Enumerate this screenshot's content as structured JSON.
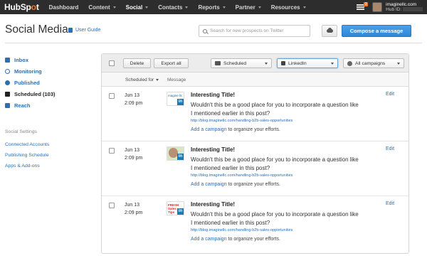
{
  "nav": {
    "logo_prefix": "HubSp",
    "logo_o": "o",
    "logo_suffix": "t",
    "items": [
      {
        "label": "Dashboard"
      },
      {
        "label": "Content"
      },
      {
        "label": "Social"
      },
      {
        "label": "Contacts"
      },
      {
        "label": "Reports"
      },
      {
        "label": "Partner"
      },
      {
        "label": "Resources"
      }
    ],
    "notification_count": "3",
    "account_name": "imaginellc.com",
    "hub_id_label": "Hub ID:"
  },
  "header": {
    "title": "Social Media",
    "user_guide": "User Guide",
    "search_placeholder": "Search for new prospects on Twitter",
    "compose": "Compose a message"
  },
  "sidebar": {
    "items": [
      {
        "label": "Inbox",
        "icon": "inbox-icon"
      },
      {
        "label": "Monitoring",
        "icon": "search-icon"
      },
      {
        "label": "Published",
        "icon": "check-icon"
      },
      {
        "label": "Scheduled (103)",
        "icon": "calendar-icon"
      },
      {
        "label": "Reach",
        "icon": "chart-icon"
      }
    ],
    "settings_heading": "Social Settings",
    "settings_links": [
      {
        "label": "Connected Accounts"
      },
      {
        "label": "Publishing Schedule"
      },
      {
        "label": "Apps & Add-ons"
      }
    ]
  },
  "toolbar": {
    "delete": "Delete",
    "export": "Export all",
    "status_select": "Scheduled",
    "network_select": "LinkedIn",
    "campaign_select": "All campaigns"
  },
  "table": {
    "col_scheduled": "Scheduled for",
    "col_message": "Message",
    "rows": [
      {
        "date": "Jun 13",
        "time": "2:09 pm",
        "thumb_text": "magine llc",
        "title": "Interesting Title!",
        "body": "Wouldn't this be a good place for you to incorporate a question like I mentioned earlier in this post?",
        "link": "http://blog.imaginellc.com/handling-b2b-sales-opportunities",
        "campaign_link": "Add a campaign",
        "campaign_rest": " to organize your efforts.",
        "edit": "Edit"
      },
      {
        "date": "Jun 13",
        "time": "2:09 pm",
        "thumb_text": "",
        "title": "Interesting Title!",
        "body": "Wouldn't this be a good place for you to incorporate a question like I mentioned earlier in this post?",
        "link": "http://blog.imaginellc.com/handling-b2b-sales-opportunities",
        "campaign_link": "Add a campaign",
        "campaign_rest": " to organize your efforts.",
        "edit": "Edit"
      },
      {
        "date": "Jun 13",
        "time": "2:09 pm",
        "thumb_text": "FRESH Sales Tips",
        "title": "Interesting Title!",
        "body": "Wouldn't this be a good place for you to incorporate a question like I mentioned earlier in this post?",
        "link": "http://blog.imaginellc.com/handling-b2b-sales-opportunities",
        "campaign_link": "Add a campaign",
        "campaign_rest": " to organize your efforts.",
        "edit": "Edit"
      }
    ]
  },
  "colors": {
    "nav_bg": "#2d2d2d",
    "link": "#2b6fb6",
    "primary_button": "#2e86d6",
    "accent": "#f47622",
    "linkedin": "#1e78b4"
  }
}
